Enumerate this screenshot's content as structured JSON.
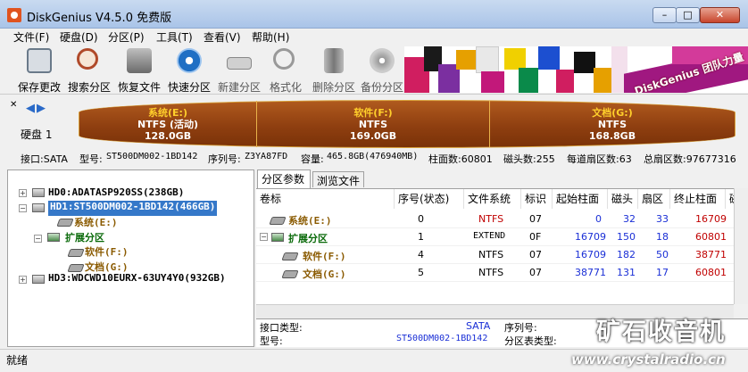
{
  "window": {
    "title": "DiskGenius V4.5.0 免费版",
    "min": "–",
    "max": "□",
    "close": "✕"
  },
  "menu": [
    "文件(F)",
    "硬盘(D)",
    "分区(P)",
    "工具(T)",
    "查看(V)",
    "帮助(H)"
  ],
  "toolbar": [
    {
      "label": "保存更改",
      "icon": "save-icon",
      "color": "#6a7a8a"
    },
    {
      "label": "搜索分区",
      "icon": "magnifier-icon",
      "color": "#b04a2a"
    },
    {
      "label": "恢复文件",
      "icon": "restore-icon",
      "color": "#6a6a6a"
    },
    {
      "label": "快速分区",
      "icon": "quick-partition-icon",
      "color": "#1f6fc4"
    },
    {
      "label": "新建分区",
      "icon": "new-partition-icon",
      "color": "#888888"
    },
    {
      "label": "格式化",
      "icon": "format-icon",
      "color": "#888888"
    },
    {
      "label": "删除分区",
      "icon": "trash-icon",
      "color": "#7a7a7a"
    },
    {
      "label": "备份分区",
      "icon": "backup-disc-icon",
      "color": "#7a7a7a"
    }
  ],
  "banner": {
    "text": "DiskGenius 团队力量"
  },
  "disk_strip": {
    "disk_label": "硬盘 1",
    "partitions": [
      {
        "name": "系统(E:)",
        "fs": "NTFS (活动)",
        "size": "128.0GB"
      },
      {
        "name": "软件(F:)",
        "fs": "NTFS",
        "size": "169.0GB"
      },
      {
        "name": "文档(G:)",
        "fs": "NTFS",
        "size": "168.8GB"
      }
    ]
  },
  "info": {
    "interface": "接口:SATA",
    "model_label": "型号:",
    "model": "ST500DM002-1BD142",
    "serial_label": "序列号:",
    "serial": "Z3YA87FD",
    "capacity_label": "容量:",
    "capacity": "465.8GB(476940MB)",
    "cylinders": "柱面数:60801",
    "heads": "磁头数:255",
    "sectors": "每道扇区数:63",
    "total": "总扇区数:97677316"
  },
  "tree": [
    {
      "label": "HD0:ADATASP920SS(238GB)"
    },
    {
      "label": "HD1:ST500DM002-1BD142(466GB)"
    },
    {
      "label": "系统(E:)"
    },
    {
      "label": "扩展分区"
    },
    {
      "label": "软件(F:)"
    },
    {
      "label": "文档(G:)"
    },
    {
      "label": "HD3:WDCWD10EURX-63UY4Y0(932GB)"
    }
  ],
  "tabs": [
    "分区参数",
    "浏览文件"
  ],
  "table": {
    "headers": [
      "卷标",
      "序号(状态)",
      "文件系统",
      "标识",
      "起始柱面",
      "磁头",
      "扇区",
      "终止柱面",
      "磁"
    ],
    "rows": [
      {
        "label": "系统(E:)",
        "num": "0",
        "fs": "NTFS",
        "id": "07",
        "start": "0",
        "head": "32",
        "sector": "33",
        "end": "16709"
      },
      {
        "label": "扩展分区",
        "num": "1",
        "fs": "EXTEND",
        "id": "0F",
        "start": "16709",
        "head": "150",
        "sector": "18",
        "end": "60801"
      },
      {
        "label": "软件(F:)",
        "num": "4",
        "fs": "NTFS",
        "id": "07",
        "start": "16709",
        "head": "182",
        "sector": "50",
        "end": "38771"
      },
      {
        "label": "文档(G:)",
        "num": "5",
        "fs": "NTFS",
        "id": "07",
        "start": "38771",
        "head": "131",
        "sector": "17",
        "end": "60801"
      }
    ]
  },
  "details": {
    "iface_label": "接口类型:",
    "iface_value": "SATA",
    "serial_label": "序列号:",
    "model_label": "型号:",
    "model_value": "ST500DM002-1BD142",
    "ptype_label": "分区表类型:"
  },
  "status": "就绪",
  "watermark": {
    "line1": "矿石收音机",
    "line2": "www.crystalradio.cn"
  }
}
